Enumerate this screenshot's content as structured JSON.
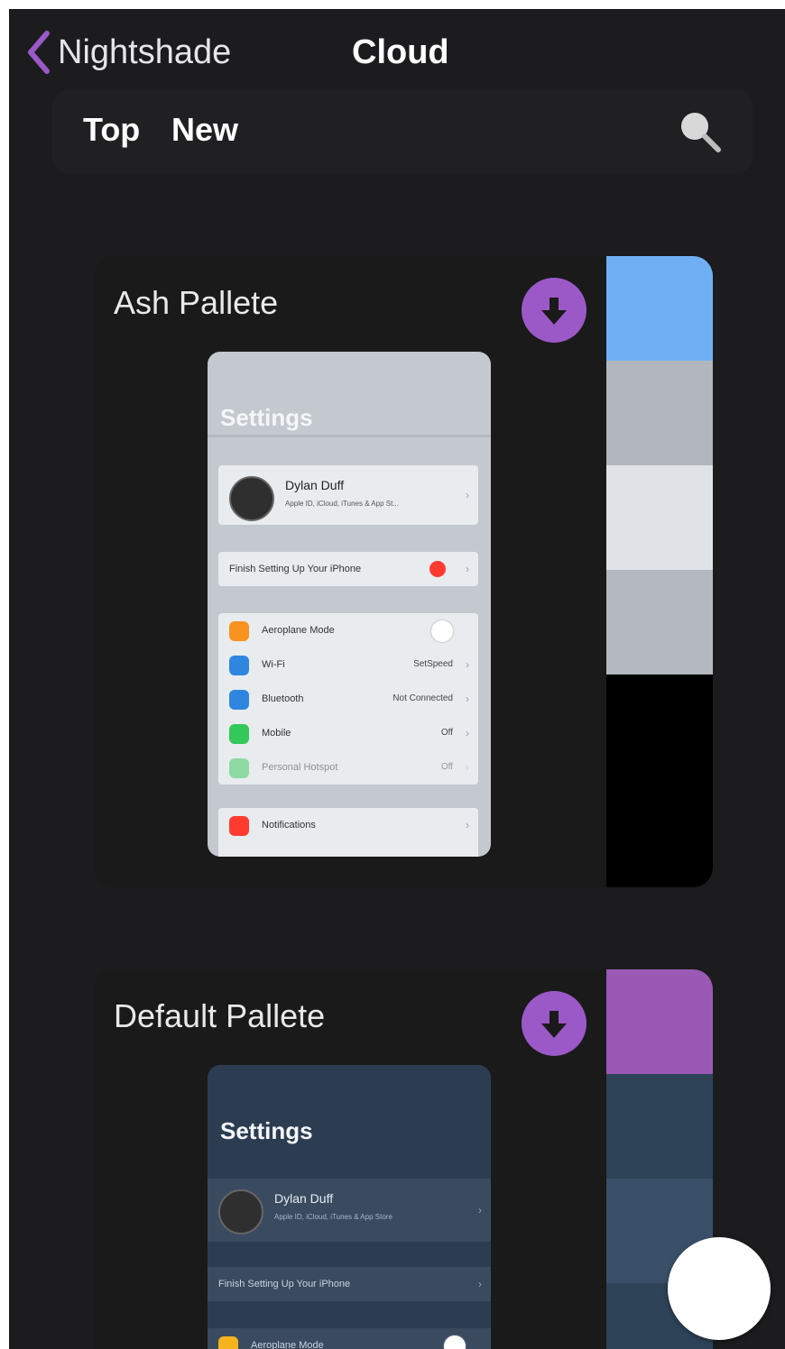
{
  "nav": {
    "back_label": "Nightshade",
    "title": "Cloud"
  },
  "segments": {
    "top": "Top",
    "new": "New"
  },
  "cards": [
    {
      "title": "Ash Pallete",
      "swatches": [
        "#6fb0f5",
        "#b1b7bd",
        "#dfe3e7",
        "#b3b9bf",
        "#000000"
      ],
      "preview": {
        "title": "Settings",
        "profile_name": "Dylan Duff",
        "profile_sub": "Apple ID, iCloud, iTunes & App St...",
        "finish_setup": "Finish Setting Up Your iPhone",
        "rows": [
          {
            "label": "Aeroplane Mode",
            "value": ""
          },
          {
            "label": "Wi-Fi",
            "value": "SetSpeed"
          },
          {
            "label": "Bluetooth",
            "value": "Not Connected"
          },
          {
            "label": "Mobile",
            "value": "Off"
          },
          {
            "label": "Personal Hotspot",
            "value": "Off"
          }
        ],
        "notifications": "Notifications"
      }
    },
    {
      "title": "Default Pallete",
      "swatches": [
        "#9b59b6",
        "#2f4358",
        "#3a5068",
        "#2f4358"
      ],
      "preview": {
        "title": "Settings",
        "profile_name": "Dylan Duff",
        "profile_sub": "Apple ID, iCloud, iTunes & App Store",
        "finish_setup": "Finish Setting Up Your iPhone",
        "first_row": "Aeroplane Mode"
      }
    }
  ],
  "colors": {
    "accent": "#9b59c8",
    "background": "#1c1c1e"
  }
}
